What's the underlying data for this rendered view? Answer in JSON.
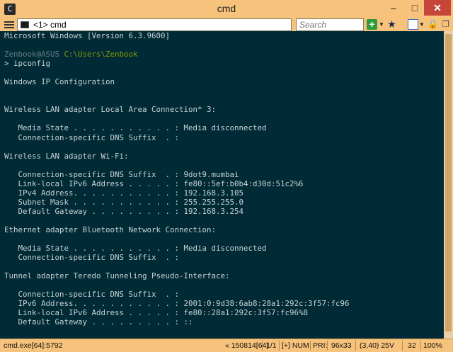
{
  "window": {
    "title": "cmd",
    "app_icon": "C"
  },
  "toolbar": {
    "tab_label": "<1> cmd",
    "search_placeholder": "Search",
    "icons": [
      "menu-icon",
      "console-icon",
      "new-console-icon",
      "dropdown-icon",
      "star-icon",
      "view-icon",
      "lock-icon",
      "copy-icon"
    ]
  },
  "console": {
    "version_line": "Microsoft Windows [Version 6.3.9600]",
    "prompt_user": "Zenbook@ASUS",
    "prompt_path": "C:\\Users\\Zenbook",
    "command_line": "> ipconfig",
    "output": "Windows IP Configuration\n\n\nWireless LAN adapter Local Area Connection* 3:\n\n   Media State . . . . . . . . . . . : Media disconnected\n   Connection-specific DNS Suffix  . :\n\nWireless LAN adapter Wi-Fi:\n\n   Connection-specific DNS Suffix  . : 9dot9.mumbai\n   Link-local IPv6 Address . . . . . : fe80::5ef:b0b4:d30d:51c2%6\n   IPv4 Address. . . . . . . . . . . : 192.168.3.105\n   Subnet Mask . . . . . . . . . . . : 255.255.255.0\n   Default Gateway . . . . . . . . . : 192.168.3.254\n\nEthernet adapter Bluetooth Network Connection:\n\n   Media State . . . . . . . . . . . : Media disconnected\n   Connection-specific DNS Suffix  . :\n\nTunnel adapter Teredo Tunneling Pseudo-Interface:\n\n   Connection-specific DNS Suffix  . :\n   IPv6 Address. . . . . . . . . . . : 2001:0:9d38:6ab8:28a1:292c:3f57:fc96\n   Link-local IPv6 Address . . . . . : fe80::28a1:292c:3f57:fc96%8\n   Default Gateway . . . . . . . . . : ::"
  },
  "statusbar": {
    "process": "cmd.exe[64]:5792",
    "build": "« 150814[64]",
    "console_index": "1/1",
    "flags": "[+] NUM",
    "priority": "PRI:",
    "size": "96x33",
    "cursor": "(3,40) 25V",
    "count": "32",
    "zoom": "100%"
  },
  "colors": {
    "console_bg": "#002b36",
    "console_text": "#c7d1d4",
    "prompt_user": "#657b83",
    "prompt_path": "#859900",
    "window_frame": "#f6c27c",
    "close_button": "#c7463a"
  }
}
